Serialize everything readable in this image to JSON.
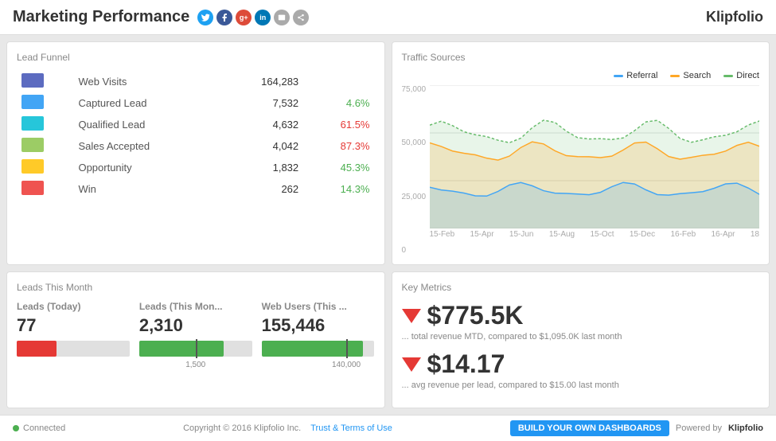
{
  "header": {
    "title": "Marketing Performance",
    "logo": "Klipfolio",
    "social": [
      {
        "name": "twitter",
        "color": "#1da1f2",
        "label": "T"
      },
      {
        "name": "facebook",
        "color": "#3b5998",
        "label": "f"
      },
      {
        "name": "google-plus",
        "color": "#dd4b39",
        "label": "g+"
      },
      {
        "name": "linkedin",
        "color": "#0077b5",
        "label": "in"
      },
      {
        "name": "email",
        "color": "#888",
        "label": "@"
      },
      {
        "name": "share",
        "color": "#888",
        "label": "⊕"
      }
    ]
  },
  "leadFunnel": {
    "title": "Lead Funnel",
    "rows": [
      {
        "label": "Web Visits",
        "value": "164,283",
        "pct": "",
        "pct_class": "",
        "color": "#5c6bc0"
      },
      {
        "label": "Captured Lead",
        "value": "7,532",
        "pct": "4.6%",
        "pct_class": "pct-green",
        "color": "#42a5f5"
      },
      {
        "label": "Qualified Lead",
        "value": "4,632",
        "pct": "61.5%",
        "pct_class": "pct-red",
        "color": "#26c6da"
      },
      {
        "label": "Sales Accepted",
        "value": "4,042",
        "pct": "87.3%",
        "pct_class": "pct-red",
        "color": "#9ccc65"
      },
      {
        "label": "Opportunity",
        "value": "1,832",
        "pct": "45.3%",
        "pct_class": "pct-green",
        "color": "#ffca28"
      },
      {
        "label": "Win",
        "value": "262",
        "pct": "14.3%",
        "pct_class": "pct-green",
        "color": "#ef5350"
      }
    ]
  },
  "trafficSources": {
    "title": "Traffic Sources",
    "legend": [
      {
        "label": "Referral",
        "color": "#42a5f5"
      },
      {
        "label": "Search",
        "color": "#ffa726"
      },
      {
        "label": "Direct",
        "color": "#66bb6a"
      }
    ],
    "yLabels": [
      "75,000",
      "50,000",
      "25,000",
      "0"
    ],
    "xLabels": [
      "15-Feb",
      "15-Apr",
      "15-Jun",
      "15-Aug",
      "15-Oct",
      "15-Dec",
      "16-Feb",
      "16-Apr",
      "18"
    ]
  },
  "leadsThisMonth": {
    "title": "Leads This Month",
    "metrics": [
      {
        "label": "Leads (Today)",
        "value": "77",
        "bar_fill_pct": 35,
        "bar_color": "#e53935",
        "marker_pct": 60,
        "marker_label": ""
      },
      {
        "label": "Leads (This Mon...",
        "value": "2,310",
        "bar_fill_pct": 75,
        "bar_color": "#4caf50",
        "marker_pct": 50,
        "marker_label": "1,500"
      },
      {
        "label": "Web Users (This ...",
        "value": "155,446",
        "bar_fill_pct": 90,
        "bar_color": "#4caf50",
        "marker_pct": 75,
        "marker_label": "140,000"
      }
    ]
  },
  "keyMetrics": {
    "title": "Key Metrics",
    "metrics": [
      {
        "value": "$775.5K",
        "desc": "... total revenue MTD, compared to $1,095.0K last month"
      },
      {
        "value": "$14.17",
        "desc": "... avg revenue per lead, compared to $15.00 last month"
      }
    ]
  },
  "footer": {
    "connected": "Connected",
    "copyright": "Copyright © 2016 Klipfolio Inc.",
    "terms": "Trust & Terms of Use",
    "build_btn": "BUILD YOUR OWN DASHBOARDS",
    "powered": "Powered by",
    "logo": "Klipfolio"
  }
}
